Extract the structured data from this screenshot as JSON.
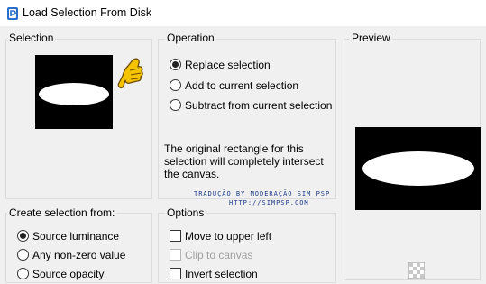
{
  "window": {
    "title": "Load Selection From Disk"
  },
  "selection_group": {
    "label": "Selection"
  },
  "operation": {
    "label": "Operation",
    "options": [
      {
        "label": "Replace selection",
        "checked": true
      },
      {
        "label": "Add to current selection",
        "checked": false
      },
      {
        "label": "Subtract from current selection",
        "checked": false
      }
    ],
    "description_lines": [
      "The original rectangle for this",
      "selection will completely intersect",
      "the canvas."
    ]
  },
  "watermark": {
    "line1": "TRADUÇÃO BY MODERAÇÃO SIM PSP",
    "line2": "HTTP://SIMPSP.COM"
  },
  "preview_group": {
    "label": "Preview"
  },
  "create_from": {
    "label": "Create selection from:",
    "options": [
      {
        "label": "Source luminance",
        "checked": true
      },
      {
        "label": "Any non-zero value",
        "checked": false
      },
      {
        "label": "Source opacity",
        "checked": false
      }
    ]
  },
  "options_group": {
    "label": "Options",
    "items": [
      {
        "label": "Move to upper left",
        "checked": false,
        "enabled": true
      },
      {
        "label": "Clip to canvas",
        "checked": false,
        "enabled": false
      },
      {
        "label": "Invert selection",
        "checked": false,
        "enabled": true
      }
    ]
  },
  "icons": {
    "app": "psp-app-icon",
    "pointer": "pointing-hand-icon",
    "transparency": "checkerboard-icon"
  },
  "colors": {
    "accent_pointer": "#f5c400",
    "thumb_bg": "#000000",
    "selection_fill": "#ffffff"
  }
}
